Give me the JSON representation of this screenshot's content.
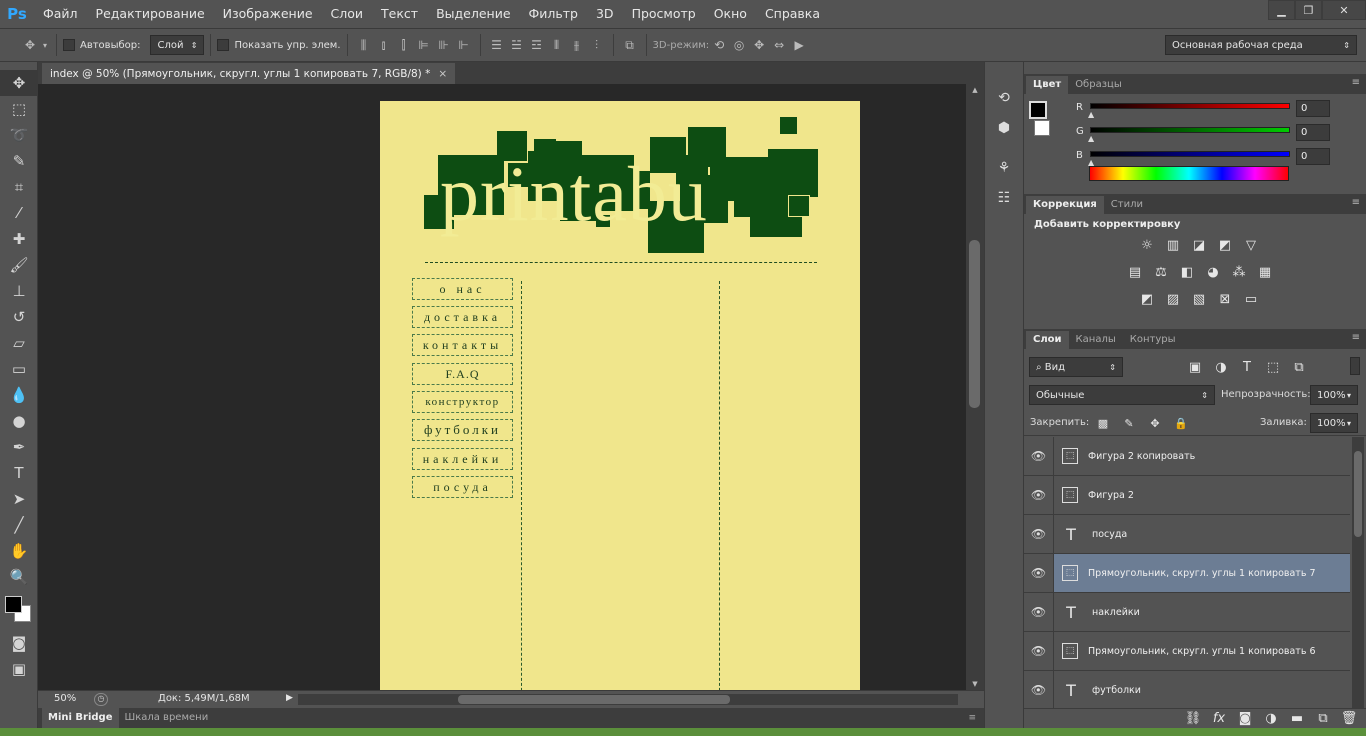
{
  "app": {
    "logo": "Ps"
  },
  "menu": [
    "Файл",
    "Редактирование",
    "Изображение",
    "Слои",
    "Текст",
    "Выделение",
    "Фильтр",
    "3D",
    "Просмотр",
    "Окно",
    "Справка"
  ],
  "window_buttons": {
    "minimize": "▁",
    "maximize": "❐",
    "close": "✕"
  },
  "options": {
    "autoselect_label": "Автовыбор:",
    "autoselect_value": "Слой",
    "show_transform_label": "Показать упр. элем.",
    "mode_3d_label": "3D-режим:",
    "workspace": "Основная рабочая среда"
  },
  "document": {
    "tab_title": "index @ 50% (Прямоугольник, скругл. углы 1 копировать 7, RGB/8) *",
    "tab_close": "×",
    "logo_text": "printabu",
    "nav": [
      "о нас",
      "доставка",
      "контакты",
      "F.A.Q",
      "конструктор",
      "футболки",
      "наклейки",
      "посуда"
    ]
  },
  "status": {
    "zoom": "50%",
    "doc_info": "Док: 5,49M/1,68M"
  },
  "bottom_tabs": [
    "Mini Bridge",
    "Шкала времени"
  ],
  "color_panel": {
    "tabs": [
      "Цвет",
      "Образцы"
    ],
    "channels": [
      {
        "label": "R",
        "value": "0",
        "color": "#ff0000"
      },
      {
        "label": "G",
        "value": "0",
        "color": "#00cc00"
      },
      {
        "label": "B",
        "value": "0",
        "color": "#0000ff"
      }
    ]
  },
  "adjust_panel": {
    "tabs": [
      "Коррекция",
      "Стили"
    ],
    "title": "Добавить корректировку"
  },
  "layers_panel": {
    "tabs": [
      "Слои",
      "Каналы",
      "Контуры"
    ],
    "filter_label": "Вид",
    "blend_mode": "Обычные",
    "opacity_label": "Непрозрачность:",
    "opacity_value": "100%",
    "lock_label": "Закрепить:",
    "fill_label": "Заливка:",
    "fill_value": "100%",
    "layers": [
      {
        "name": "Фигура 2 копировать",
        "kind": "shape",
        "selected": false
      },
      {
        "name": "Фигура 2",
        "kind": "shape",
        "selected": false
      },
      {
        "name": "посуда",
        "kind": "text",
        "selected": false
      },
      {
        "name": "Прямоугольник, скругл. углы 1 копировать 7",
        "kind": "shape",
        "selected": true
      },
      {
        "name": "наклейки",
        "kind": "text",
        "selected": false
      },
      {
        "name": "Прямоугольник, скругл. углы 1 копировать 6",
        "kind": "shape",
        "selected": false
      },
      {
        "name": "футболки",
        "kind": "text",
        "selected": false
      }
    ]
  },
  "colors": {
    "canvas_bg": "#f0e68c",
    "logo_green": "#0d4d12",
    "selection": "#6c7d94"
  }
}
